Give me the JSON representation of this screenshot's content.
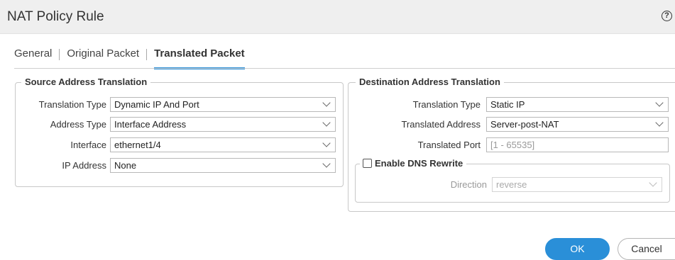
{
  "dialog": {
    "title": "NAT Policy Rule",
    "help_icon": "?"
  },
  "tabs": [
    {
      "label": "General",
      "active": false
    },
    {
      "label": "Original Packet",
      "active": false
    },
    {
      "label": "Translated Packet",
      "active": true
    }
  ],
  "source": {
    "legend": "Source Address Translation",
    "fields": {
      "translation_type": {
        "label": "Translation Type",
        "value": "Dynamic IP And Port"
      },
      "address_type": {
        "label": "Address Type",
        "value": "Interface Address"
      },
      "interface": {
        "label": "Interface",
        "value": "ethernet1/4"
      },
      "ip_address": {
        "label": "IP Address",
        "value": "None"
      }
    }
  },
  "destination": {
    "legend": "Destination Address Translation",
    "fields": {
      "translation_type": {
        "label": "Translation Type",
        "value": "Static IP"
      },
      "translated_address": {
        "label": "Translated Address",
        "value": "Server-post-NAT"
      },
      "translated_port": {
        "label": "Translated Port",
        "placeholder": "[1 - 65535]"
      }
    },
    "dns_rewrite": {
      "label": "Enable DNS Rewrite",
      "checked": false,
      "direction": {
        "label": "Direction",
        "value": "reverse"
      }
    }
  },
  "buttons": {
    "ok": "OK",
    "cancel": "Cancel"
  },
  "colors": {
    "accent": "#2a8fd8",
    "header_bg": "#efefef"
  }
}
